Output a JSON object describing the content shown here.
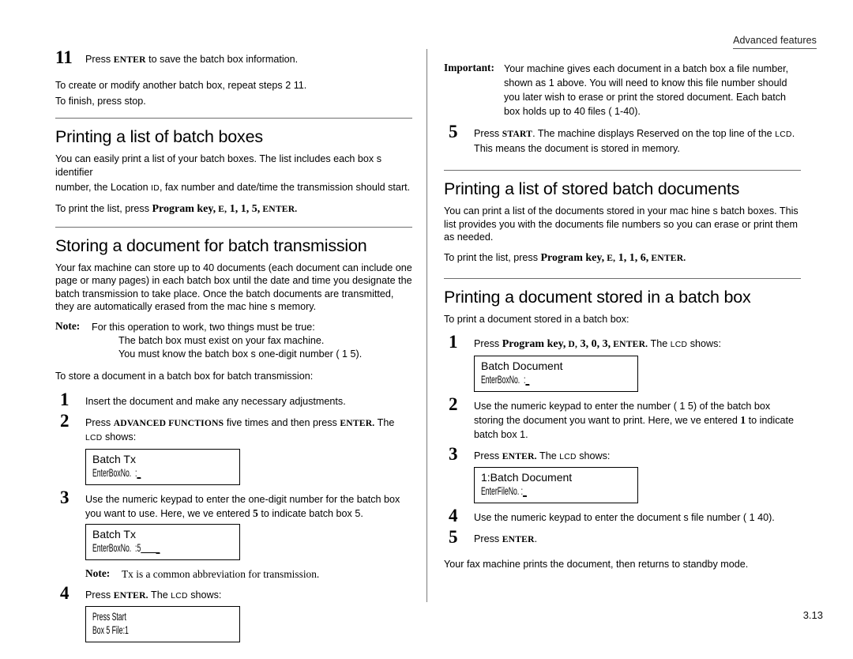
{
  "running_head": "Advanced features",
  "folio": "3.13",
  "left_column": {
    "step11": {
      "number": "11",
      "text_before": "Press ",
      "key": "ENTER",
      "text_after": " to save the batch box information."
    },
    "para_repeat_line1": "To create or modify another batch box,   repeat steps 2 11.",
    "para_repeat_line2": "To finish, press stop.",
    "section1": {
      "heading": "Printing a list of batch boxes",
      "body_line1": "You can easily print a list of your batch boxes. The list includes each box s     identifier",
      "body_line2_a": "number, the Location ",
      "body_line2_id": "ID",
      "body_line2_b": ", fax number and date/time the transmission should start.",
      "print_prefix": "To print the list, press ",
      "print_keys_main": "Program key,",
      "print_keys_sc1": " E,",
      "print_keys_mid": " 1, 1, 5,",
      "print_keys_sc2": " ENTER."
    },
    "section2": {
      "heading": "Storing a document for batch transmission",
      "body": "Your fax machine can store up to 40   documents (each document can include one page or many pages) in each batch box until the date and time you designate the batch transmission to take place. Once the batch documents are transmitted, they are automatically erased from the mac   hine s memory.",
      "note_label": "Note:",
      "note_intro": "For this operation to work, two things must be true:",
      "note_item1": "The batch box must exist on your fax machine.",
      "note_item2": "You must know the batch box s one-digit number (    1  5).",
      "lead_in": "To store a document in a batch box for batch transmission:",
      "steps": [
        {
          "number": "1",
          "text": "Insert the document and make any necessary adjustments."
        },
        {
          "number": "2",
          "text_a": "Press ",
          "key1": "ADVANCED FUNCTIONS",
          "text_b": " five times and then press ",
          "key2": "ENTER.",
          "text_c": " The ",
          "lcd_word": "LCD",
          "text_d": " shows:"
        },
        {
          "number": "3",
          "text_a": "Use the numeric keypad to enter the one-digit number for the batch box you want to use. Here, we ve entered ",
          "value": "5",
          "text_b": " to indicate batch box  5."
        },
        {
          "number": "4",
          "text_a": "Press ",
          "key1": "ENTER.",
          "text_b": " The ",
          "lcd_word": "LCD",
          "text_c": " shows:"
        }
      ],
      "lcd1": {
        "line1": "Batch Tx",
        "line2": "EnterBoxNo.  :",
        "cursor": "_"
      },
      "lcd2": {
        "line1": "Batch Tx",
        "line2": "EnterBoxNo.  :5",
        "cursor": "        _"
      },
      "lcd3": {
        "line1": "Press Start",
        "line2": "Box 5 File:1",
        "cursor": ""
      },
      "tx_note_label": "Note:",
      "tx_note_text": "Tx is a common abbreviation for   transmission."
    }
  },
  "right_column": {
    "important": {
      "label": "Important:",
      "text": "Your machine gives each document in a batch box a   file number, shown as 1 above. You will need to know this file number should you later wish to erase or print the stored document. Each batch box holds up to 40 files ( 1-40)."
    },
    "step5": {
      "number": "5",
      "text_a": "Press ",
      "key1": "START",
      "text_b": ". The machine displays   Reserved  on the top line of the ",
      "lcd_word": "LCD",
      "text_c": ".",
      "line2": "This means the document is stored in memory."
    },
    "section1": {
      "heading": "Printing a list of stored batch documents",
      "body": "You can print a list of the documents stored in your mac     hine s batch boxes. This list provides you with the documents  file numbers so you can erase or print them as needed.",
      "print_prefix": "To print the list, press ",
      "print_keys_main": "Program key,",
      "print_keys_sc1": " E,",
      "print_keys_mid": " 1, 1, 6,",
      "print_keys_sc2": " ENTER."
    },
    "section2": {
      "heading": "Printing a document stored in a batch box",
      "lead_in": "To print a document stored in a batch box:",
      "steps": [
        {
          "number": "1",
          "text_a": "Press ",
          "keys_main": "Program key,",
          "keys_sc1": " D,",
          "keys_mid": " 3, 0, 3,",
          "keys_sc2": " ENTER.",
          "text_b": " The ",
          "lcd_word": "LCD",
          "text_c": " shows:"
        },
        {
          "number": "2",
          "text_a": "Use the numeric keypad to enter the number (    1  5) of the batch box storing the document you want to print. Here, we ve entered ",
          "value": "1",
          "text_b": " to indicate batch box  1."
        },
        {
          "number": "3",
          "text_a": "Press ",
          "key1": "ENTER.",
          "text_b": " The ",
          "lcd_word": "LCD",
          "text_c": " shows:"
        },
        {
          "number": "4",
          "text": "Use the numeric keypad to enter the document s file number (     1  40)."
        },
        {
          "number": "5",
          "text_a": "Press ",
          "key1": "ENTER",
          "text_b": "."
        }
      ],
      "lcd1": {
        "line1": "Batch Document",
        "line2": "EnterBoxNo.  :",
        "cursor": "_"
      },
      "lcd2": {
        "line1": "1:Batch Document",
        "line2": "EnterFileNo. :",
        "cursor": "_"
      },
      "closing": "Your fax machine prints the document, then returns to standby mode."
    }
  }
}
